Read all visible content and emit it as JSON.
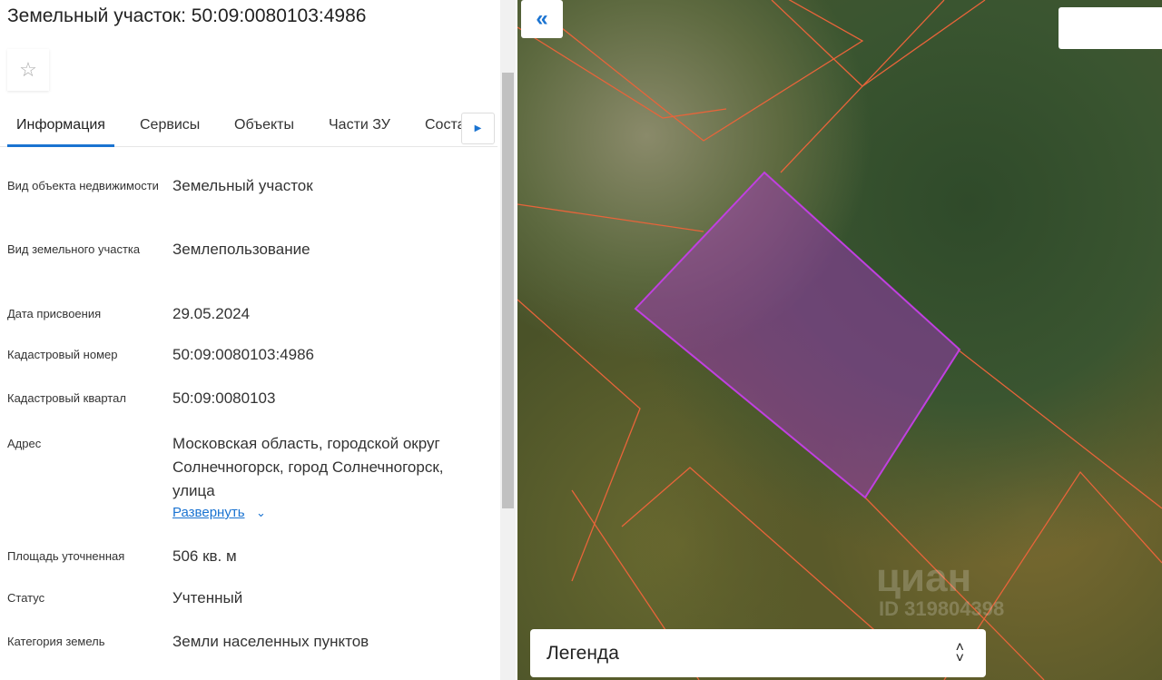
{
  "title": "Земельный участок: 50:09:0080103:4986",
  "tabs": [
    "Информация",
    "Сервисы",
    "Объекты",
    "Части ЗУ",
    "Состав"
  ],
  "fields": [
    {
      "label": "Вид объекта недвижимости",
      "value": "Земельный участок"
    },
    {
      "label": "Вид земельного участка",
      "value": "Землепользование"
    },
    {
      "label": "Дата присвоения",
      "value": "29.05.2024"
    },
    {
      "label": "Кадастровый номер",
      "value": "50:09:0080103:4986"
    },
    {
      "label": "Кадастровый квартал",
      "value": "50:09:0080103"
    },
    {
      "label": "Адрес",
      "value": "Московская область, городской округ Солнечногорск, город Солнечногорск, улица"
    },
    {
      "label": "Площадь уточненная",
      "value": "506 кв. м"
    },
    {
      "label": "Статус",
      "value": "Учтенный"
    },
    {
      "label": "Категория земель",
      "value": "Земли населенных пунктов"
    }
  ],
  "expand_label": "Развернуть",
  "map": {
    "legend_label": "Легенда",
    "watermark": "циан",
    "watermark_id": "ID 319804398",
    "parcel_color": "#c040e0",
    "boundary_color": "#e8643a"
  }
}
